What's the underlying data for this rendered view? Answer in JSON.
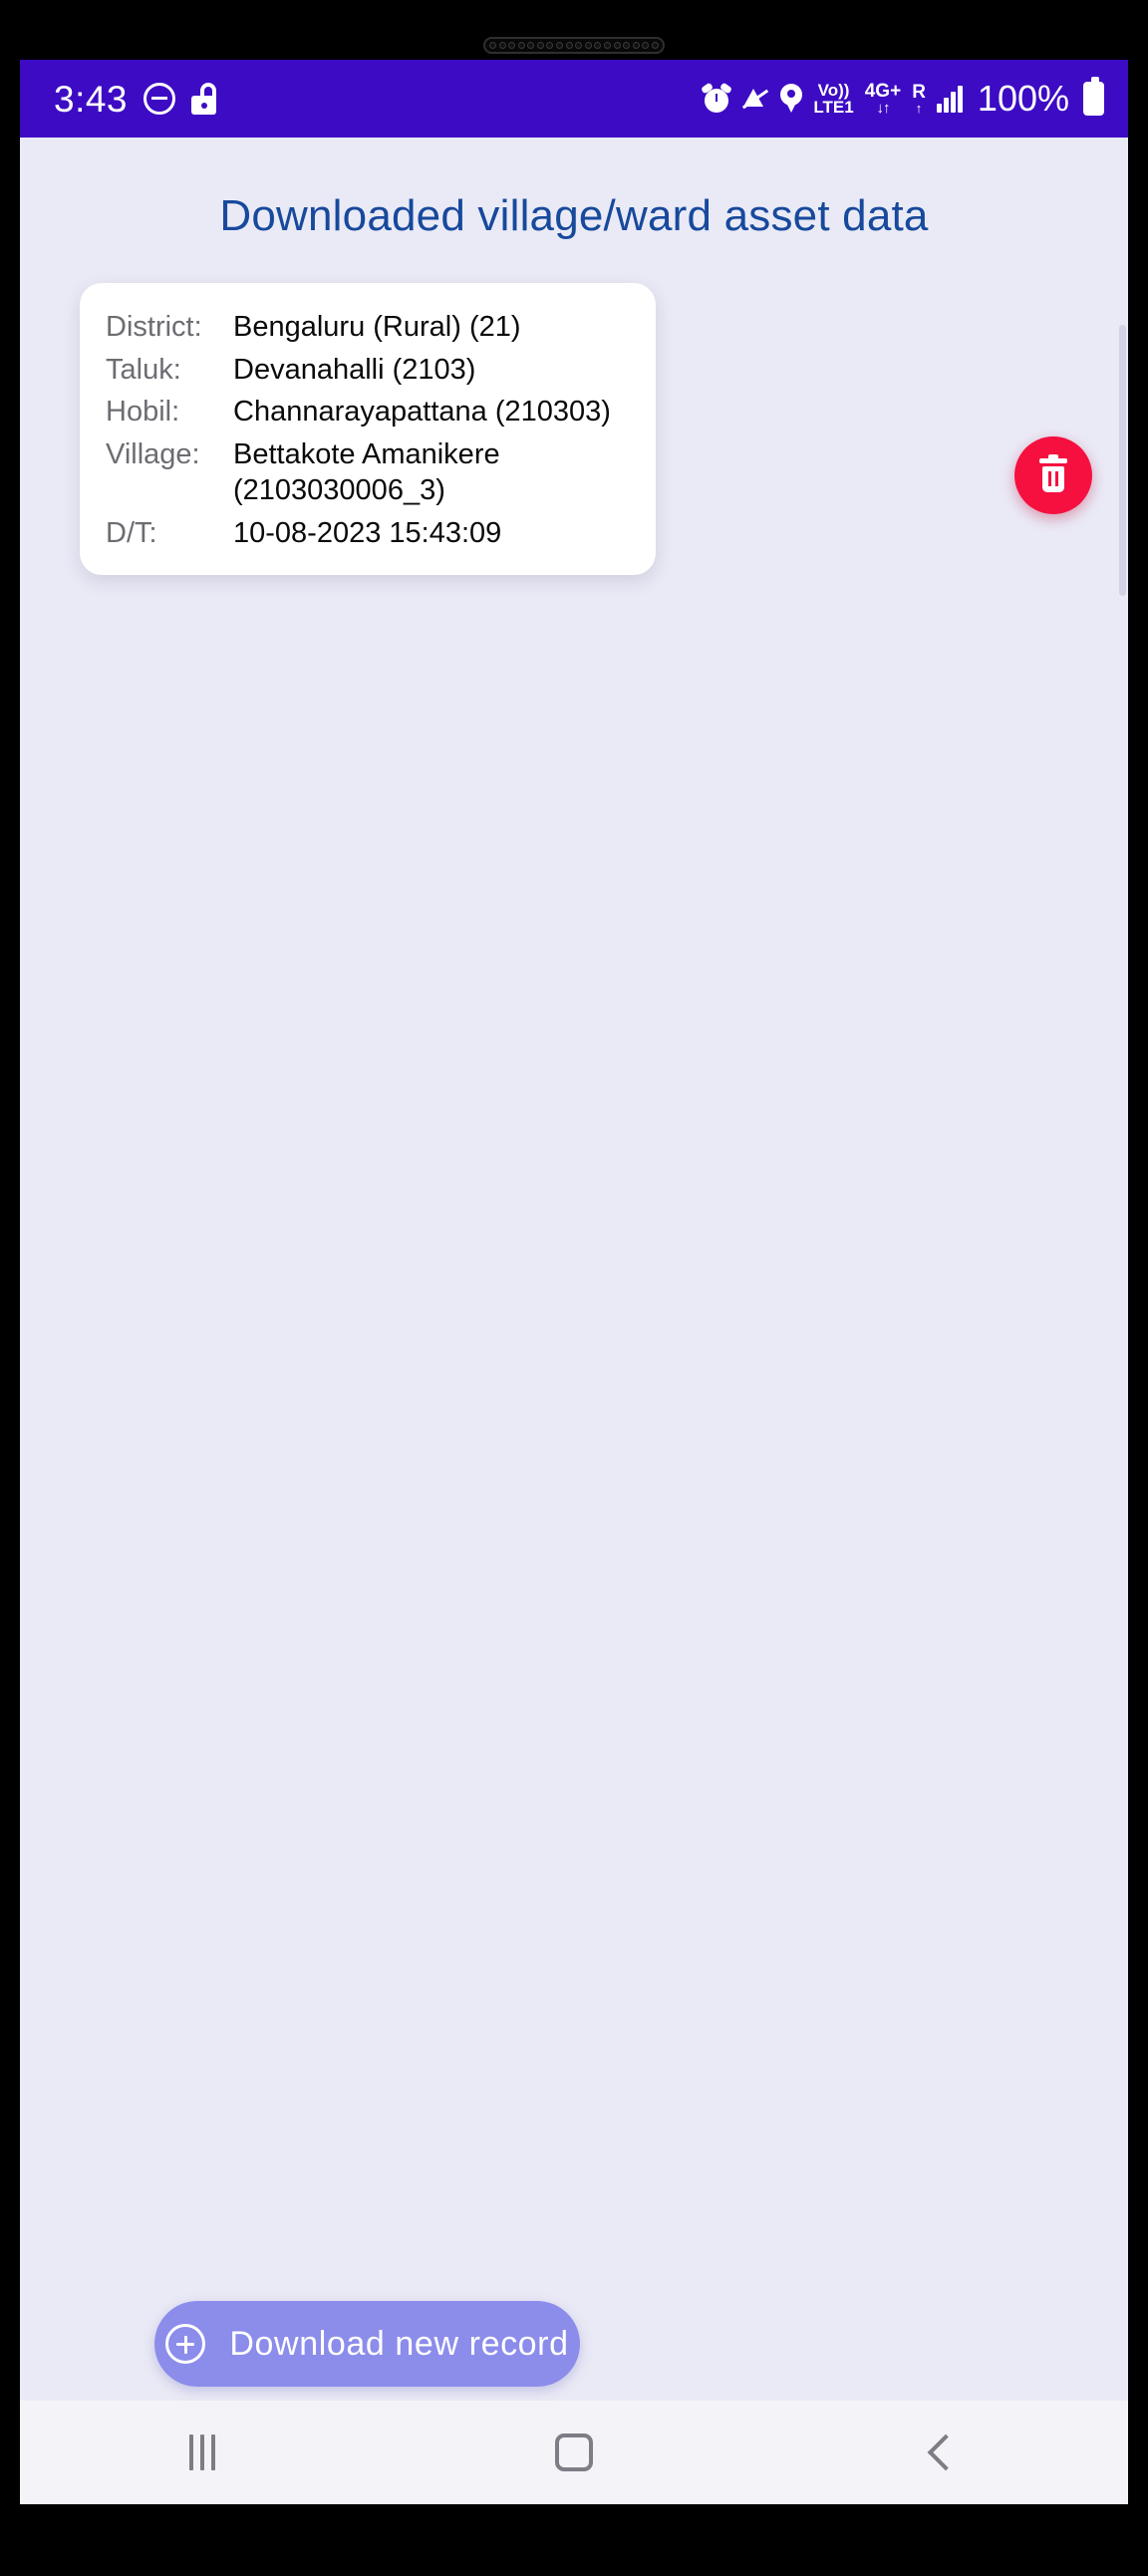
{
  "status_bar": {
    "time": "3:43",
    "dnd_icon": "do-not-disturb-icon",
    "lock_icon": "unlocked-padlock-icon",
    "alarm_icon": "alarm-clock-icon",
    "mute_icon": "bell-muted-icon",
    "location_icon": "location-pin-icon",
    "volte_top": "Vo))",
    "volte_bottom": "LTE1",
    "network_top": "4G+",
    "network_bottom": "↓↑",
    "roaming_top": "R",
    "roaming_bottom": "↑",
    "battery_percent": "100%",
    "background_color": "#3d0bc4",
    "foreground_color": "#ffffff"
  },
  "header": {
    "title": "Downloaded village/ward asset data",
    "title_color": "#17499c"
  },
  "record_card": {
    "rows": [
      {
        "label": "District:",
        "value": "Bengaluru (Rural) (21)"
      },
      {
        "label": "Taluk:",
        "value": "Devanahalli (2103)"
      },
      {
        "label": "Hobil:",
        "value": "Channarayapattana (210303)"
      },
      {
        "label": "Village:",
        "value": "Bettakote Amanikere",
        "value_line2": "(2103030006_3)"
      },
      {
        "label": "D/T:",
        "value": "10-08-2023 15:43:09"
      }
    ],
    "delete_button": {
      "icon": "trash-icon",
      "color": "#f5103f"
    }
  },
  "download_button": {
    "label": "Download new record",
    "icon": "plus-circle-icon",
    "background_color": "#8c8ceb",
    "text_color": "#ffffff"
  },
  "nav_bar": {
    "recents_icon": "recent-apps-icon",
    "home_icon": "home-icon",
    "back_icon": "back-chevron-icon"
  }
}
